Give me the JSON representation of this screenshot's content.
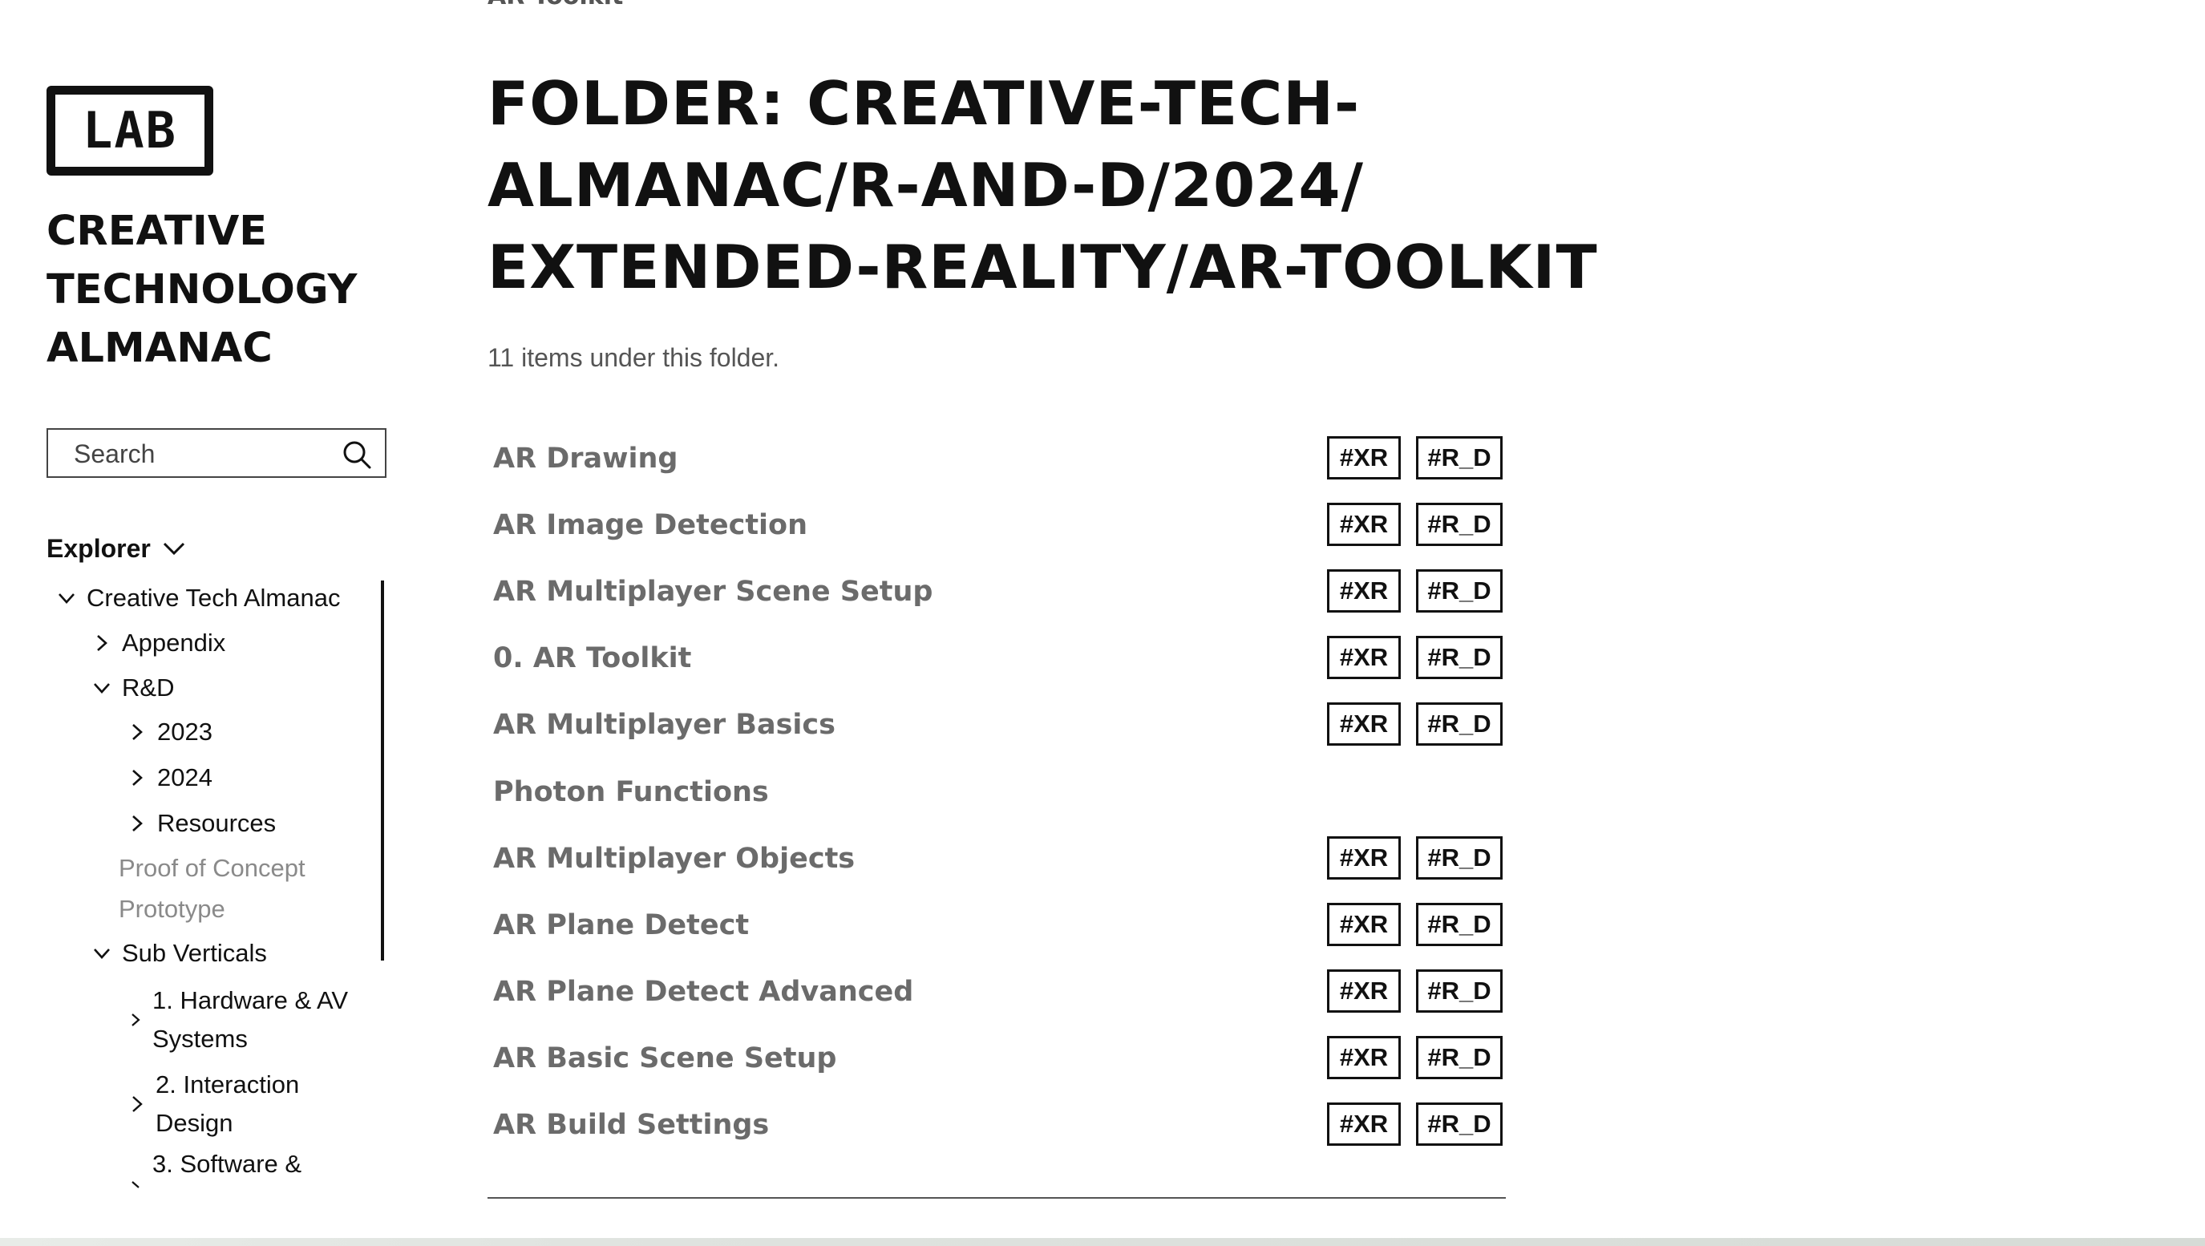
{
  "sidebar": {
    "logo_text": "LAB",
    "title_lines": [
      "CREATIVE",
      "TECHNOLOGY",
      "ALMANAC"
    ],
    "search": {
      "placeholder": "Search",
      "icon": "search-icon"
    },
    "explorer_label": "Explorer",
    "tree": [
      {
        "label": "Creative Tech Almanac",
        "state": "expanded"
      },
      {
        "label": "Appendix",
        "state": "collapsed"
      },
      {
        "label": "R&D",
        "state": "expanded"
      },
      {
        "label": "2023",
        "state": "collapsed"
      },
      {
        "label": "2024",
        "state": "collapsed"
      },
      {
        "label": "Resources",
        "state": "collapsed"
      },
      {
        "label": "Proof of Concept",
        "state": "leaf"
      },
      {
        "label": "Prototype",
        "state": "leaf"
      },
      {
        "label": "Sub Verticals",
        "state": "expanded"
      },
      {
        "label": "1. Hardware & AV Systems",
        "state": "collapsed"
      },
      {
        "label": "2. Interaction Design",
        "state": "collapsed"
      },
      {
        "label": "3. Software &",
        "state": "collapsed"
      }
    ]
  },
  "main": {
    "breadcrumb": "AR Toolkit",
    "title_lines": [
      "FOLDER: CREATIVE-TECH-",
      "ALMANAC/R-AND-D/2024/",
      "EXTENDED-REALITY/AR-TOOLKIT"
    ],
    "item_count": "11 items under this folder.",
    "items": [
      {
        "title": "AR Drawing",
        "tags": [
          "#XR",
          "#R_D"
        ]
      },
      {
        "title": "AR Image Detection",
        "tags": [
          "#XR",
          "#R_D"
        ]
      },
      {
        "title": "AR Multiplayer Scene Setup",
        "tags": [
          "#XR",
          "#R_D"
        ]
      },
      {
        "title": "0. AR Toolkit",
        "tags": [
          "#XR",
          "#R_D"
        ]
      },
      {
        "title": "AR Multiplayer Basics",
        "tags": [
          "#XR",
          "#R_D"
        ]
      },
      {
        "title": "Photon Functions",
        "tags": []
      },
      {
        "title": "AR Multiplayer Objects",
        "tags": [
          "#XR",
          "#R_D"
        ]
      },
      {
        "title": "AR Plane Detect",
        "tags": [
          "#XR",
          "#R_D"
        ]
      },
      {
        "title": "AR Plane Detect Advanced",
        "tags": [
          "#XR",
          "#R_D"
        ]
      },
      {
        "title": "AR Basic Scene Setup",
        "tags": [
          "#XR",
          "#R_D"
        ]
      },
      {
        "title": "AR Build Settings",
        "tags": [
          "#XR",
          "#R_D"
        ]
      }
    ]
  }
}
